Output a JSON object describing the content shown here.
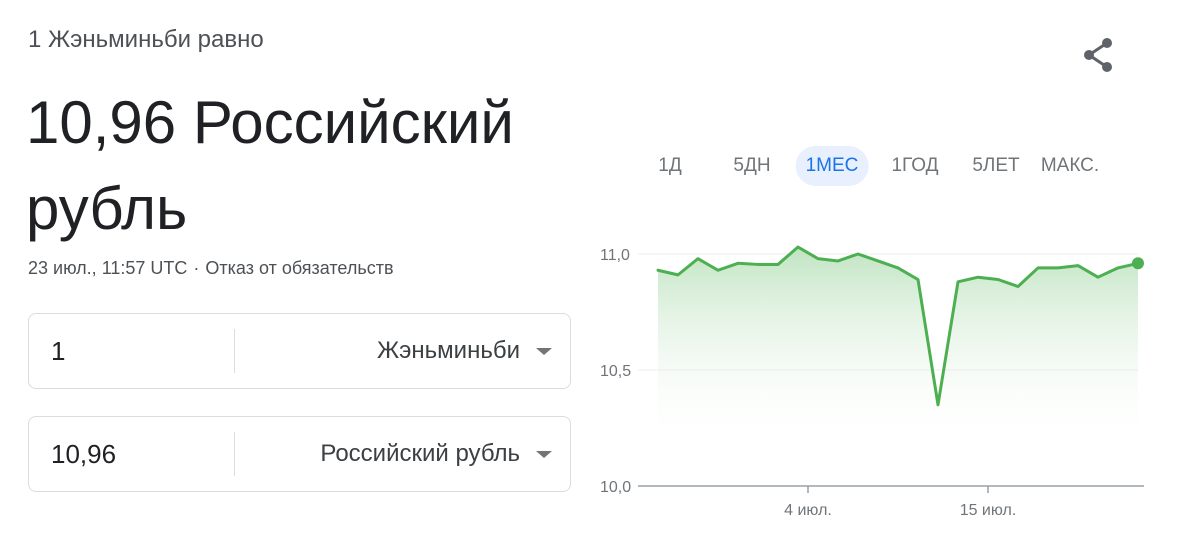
{
  "header": {
    "subtitle": "1 Жэньминьби равно",
    "value_text": "10,96 Российский рубль",
    "timestamp": "23 июл., 11:57 UTC",
    "separator": "·",
    "disclaimer": "Отказ от обязательств"
  },
  "icons": {
    "share": "share-icon",
    "caret": "chevron-down-icon"
  },
  "converter": {
    "from": {
      "amount": "1",
      "currency": "Жэньминьби"
    },
    "to": {
      "amount": "10,96",
      "currency": "Российский рубль"
    }
  },
  "range_tabs": [
    {
      "label": "1Д",
      "active": false
    },
    {
      "label": "5ДН",
      "active": false
    },
    {
      "label": "1МЕС",
      "active": true
    },
    {
      "label": "1ГОД",
      "active": false
    },
    {
      "label": "5ЛЕТ",
      "active": false
    },
    {
      "label": "МАКС.",
      "active": false
    }
  ],
  "colors": {
    "line": "#4caf50",
    "fill_top": "#b6dfb8",
    "accent": "#1a73e8",
    "text_primary": "#202124",
    "text_secondary": "#70757a"
  },
  "chart_data": {
    "type": "area",
    "ylim": [
      10.0,
      11.0
    ],
    "y_ticks": [
      {
        "value": 11.0,
        "label": "11,0"
      },
      {
        "value": 10.5,
        "label": "10,5"
      },
      {
        "value": 10.0,
        "label": "10,0"
      }
    ],
    "x_ticks": [
      {
        "index": 7.5,
        "label": "4 июл."
      },
      {
        "index": 16.5,
        "label": "15 июл."
      }
    ],
    "grid": true,
    "values": [
      10.93,
      10.91,
      10.98,
      10.93,
      10.96,
      10.955,
      10.955,
      11.03,
      10.98,
      10.97,
      11.0,
      10.97,
      10.94,
      10.89,
      10.35,
      10.88,
      10.9,
      10.89,
      10.86,
      10.94,
      10.94,
      10.95,
      10.9,
      10.94,
      10.96
    ]
  }
}
